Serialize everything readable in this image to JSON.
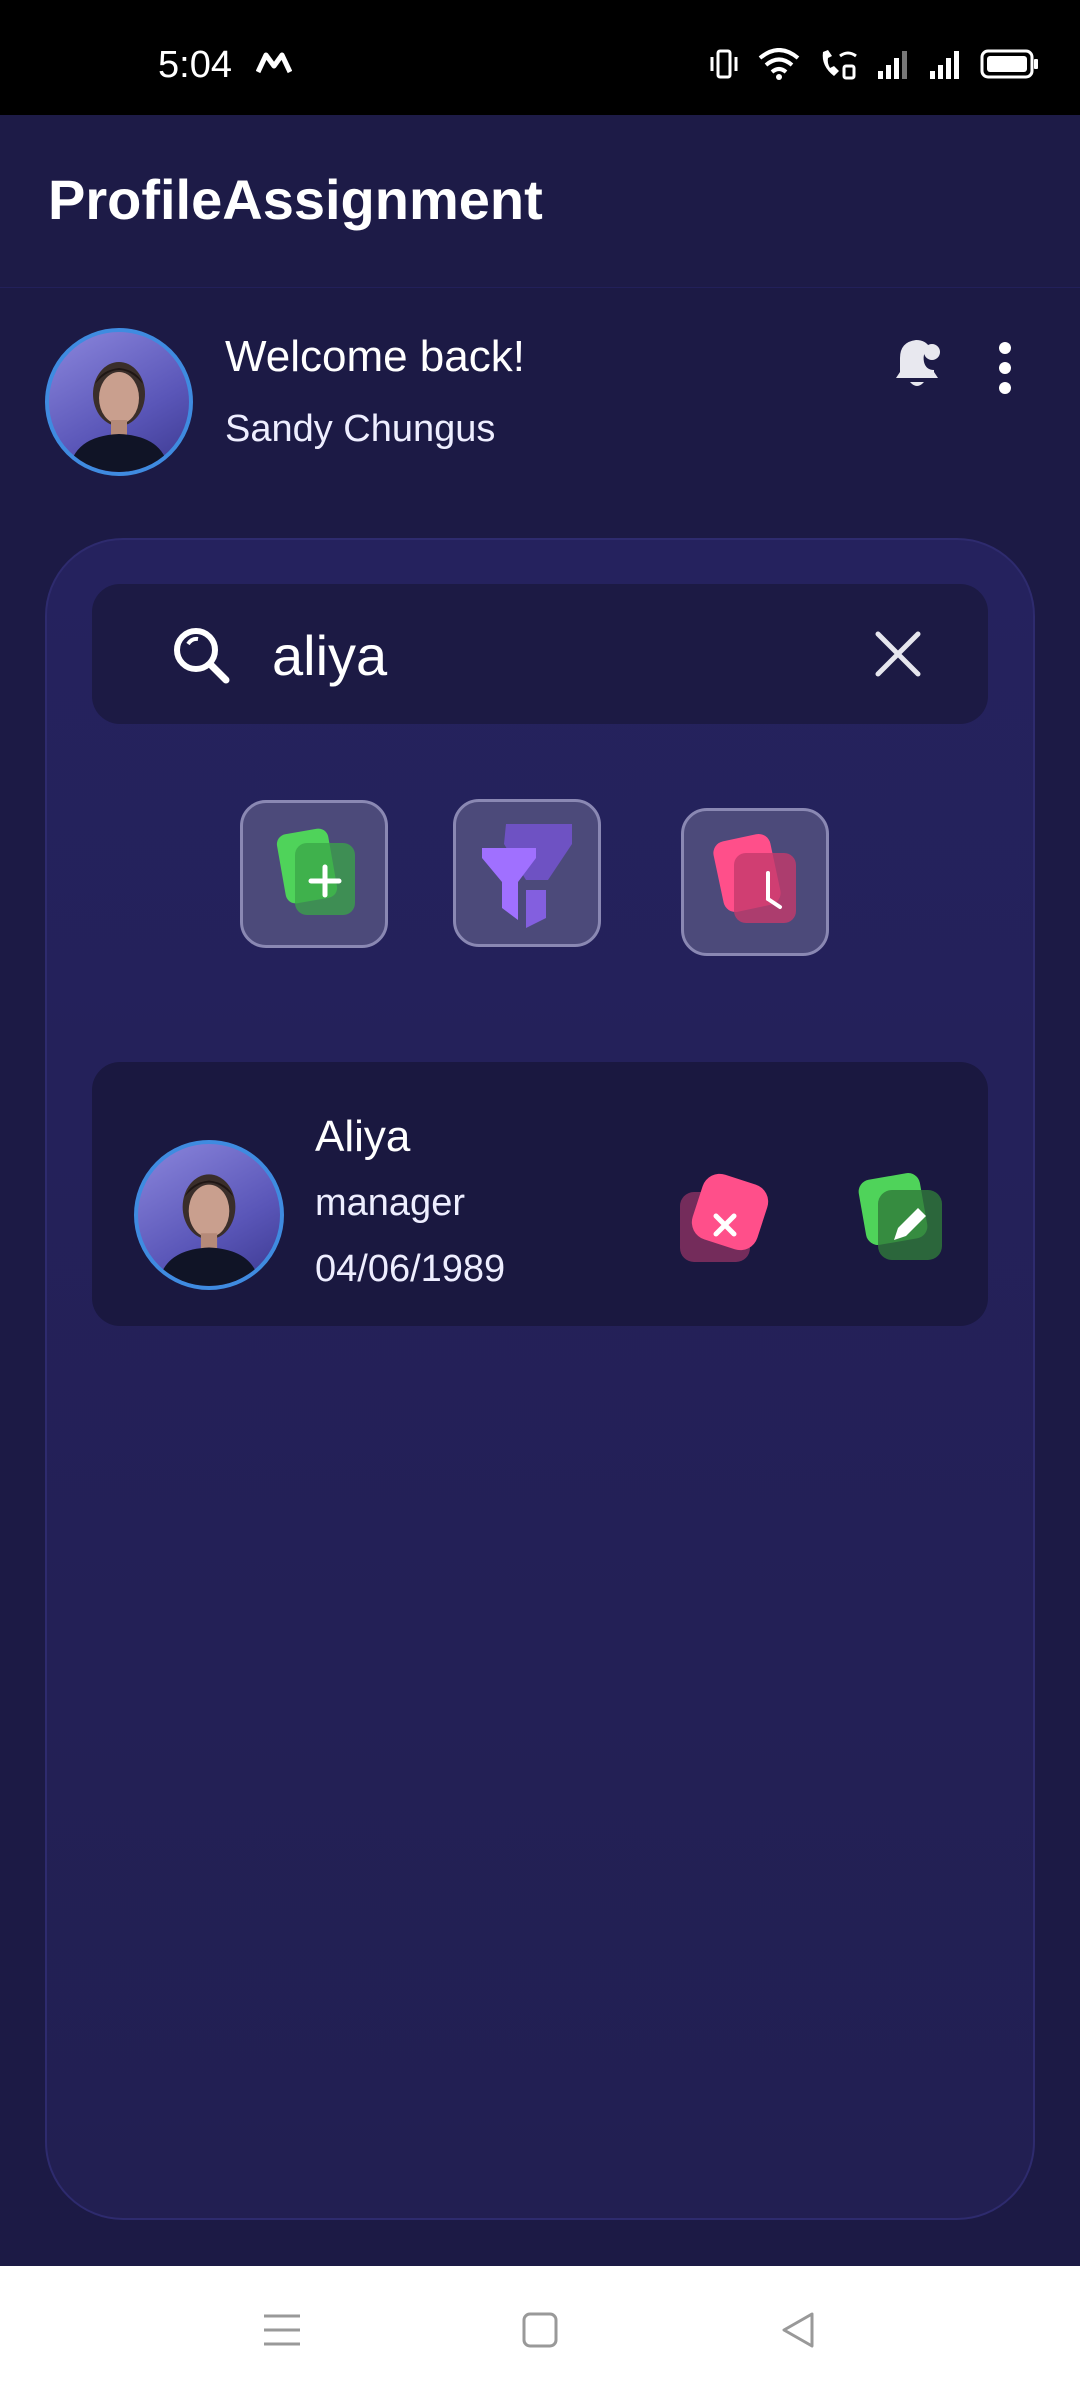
{
  "status_bar": {
    "time": "5:04",
    "icons": [
      "m-notification-icon",
      "vibrate-icon",
      "wifi-icon",
      "wifi-call-icon",
      "signal-icon",
      "signal-icon",
      "battery-icon"
    ]
  },
  "app_bar": {
    "title": "ProfileAssignment"
  },
  "user": {
    "welcome": "Welcome back!",
    "name": "Sandy Chungus",
    "actions": [
      "notification-bell-icon",
      "more-options-icon"
    ]
  },
  "search": {
    "value": "aliya",
    "icons": [
      "search-icon",
      "clear-icon"
    ]
  },
  "actions": [
    {
      "name": "add-profile-button",
      "icon": "add-icon",
      "color": "#47c24e"
    },
    {
      "name": "filter-button",
      "icon": "filter-icon",
      "color": "#8b5fe0"
    },
    {
      "name": "history-button",
      "icon": "clock-icon",
      "color": "#f04e86"
    }
  ],
  "results": [
    {
      "name": "Aliya",
      "role": "manager",
      "date": "04/06/1989",
      "actions": [
        "delete-icon",
        "edit-icon"
      ]
    }
  ],
  "colors": {
    "background": "#1c1a45",
    "card": "#24215a",
    "accent_green": "#47c24e",
    "accent_pink": "#f04e86",
    "accent_purple": "#8b5fe0"
  },
  "nav_bar": {
    "items": [
      "menu-icon",
      "home-icon",
      "back-icon"
    ]
  }
}
